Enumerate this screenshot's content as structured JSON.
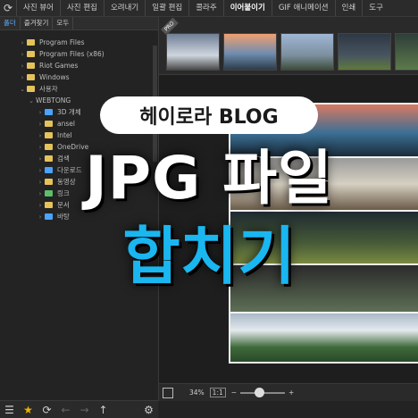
{
  "menu": {
    "items": [
      "사진 뷰어",
      "사진 편집",
      "오려내기",
      "일괄 편집",
      "콜라주",
      "이어붙이기",
      "GIF 애니메이션",
      "인쇄",
      "도구"
    ],
    "active_index": 5
  },
  "left_panel": {
    "tabs": [
      "폴더",
      "즐겨찾기",
      "모두"
    ],
    "tree": [
      {
        "label": "Program Files",
        "indent": 1,
        "icon": "folder"
      },
      {
        "label": "Program Files (x86)",
        "indent": 1,
        "icon": "folder"
      },
      {
        "label": "Riot Games",
        "indent": 1,
        "icon": "folder"
      },
      {
        "label": "Windows",
        "indent": 1,
        "icon": "folder"
      },
      {
        "label": "사용자",
        "indent": 1,
        "icon": "folder"
      },
      {
        "label": "WEBTONG",
        "indent": 2,
        "icon": "none"
      },
      {
        "label": "3D 개체",
        "indent": 3,
        "icon": "folder-blue"
      },
      {
        "label": "ansel",
        "indent": 3,
        "icon": "folder"
      },
      {
        "label": "Intel",
        "indent": 3,
        "icon": "folder"
      },
      {
        "label": "OneDrive",
        "indent": 3,
        "icon": "folder"
      },
      {
        "label": "검색",
        "indent": 3,
        "icon": "folder"
      },
      {
        "label": "다운로드",
        "indent": 3,
        "icon": "folder-blue"
      },
      {
        "label": "동영상",
        "indent": 3,
        "icon": "folder"
      },
      {
        "label": "링크",
        "indent": 3,
        "icon": "folder-green"
      },
      {
        "label": "문서",
        "indent": 3,
        "icon": "folder"
      },
      {
        "label": "바탕",
        "indent": 3,
        "icon": "folder-blue"
      }
    ]
  },
  "filmstrip": {
    "badge": "PRO"
  },
  "bottombar": {
    "zoom": "34%",
    "fit": "1:1",
    "minus": "−",
    "plus": "+"
  },
  "overlay": {
    "pill_text": "헤이로라 BLOG",
    "headline": "JPG 파일",
    "subline": "합치기"
  },
  "colors": {
    "accent": "#1ab6f0",
    "star": "#f0b400",
    "folder": "#e6c25a"
  }
}
